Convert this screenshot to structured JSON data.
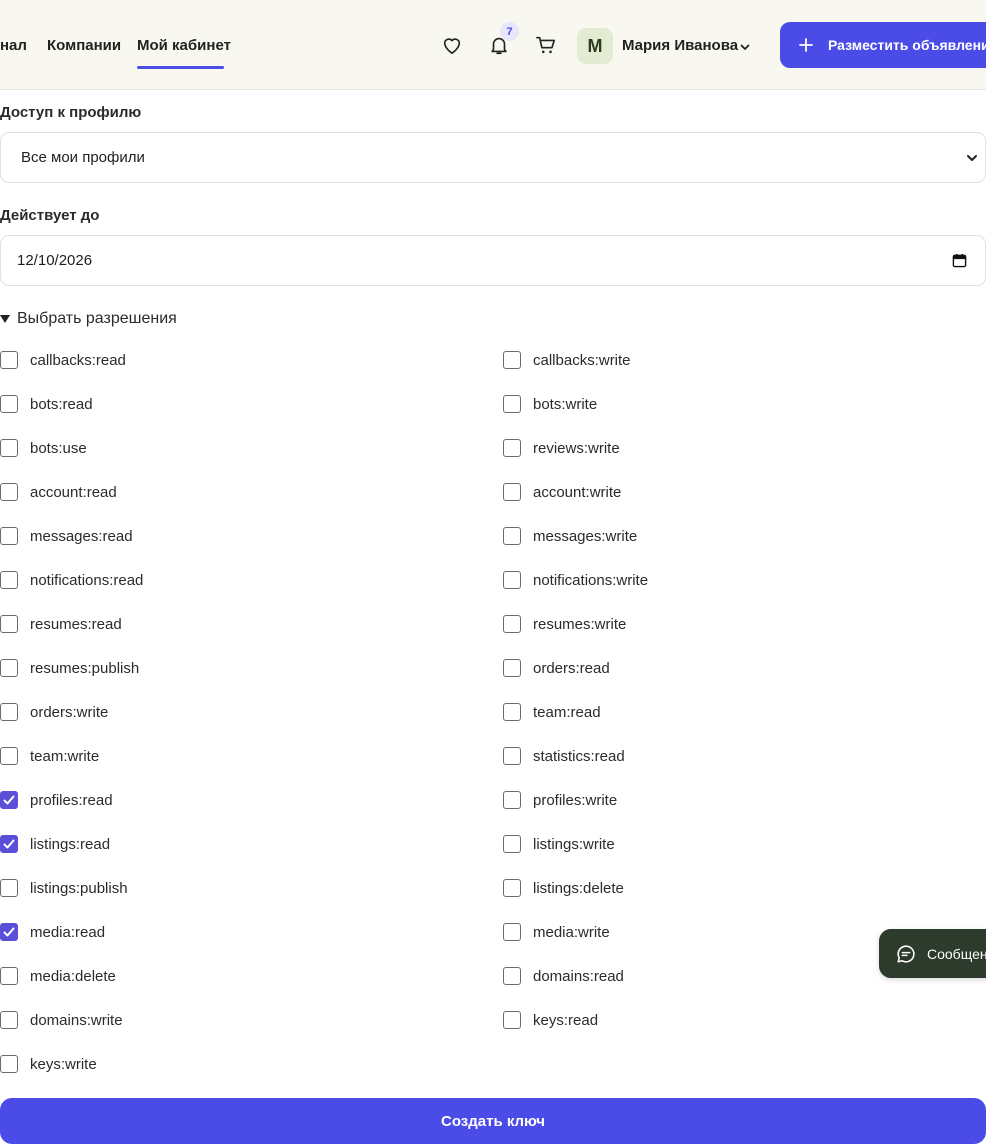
{
  "header": {
    "nav": [
      {
        "label": "нал"
      },
      {
        "label": "Компании"
      },
      {
        "label": "Мой кабинет"
      }
    ],
    "notifications_count": "7",
    "user": {
      "initial": "М",
      "name": "Мария Иванова"
    },
    "post_button_label": "Разместить объявление"
  },
  "form": {
    "profile_access": {
      "label": "Доступ к профилю",
      "value": "Все мои профили"
    },
    "valid_until": {
      "label": "Действует до",
      "value": "12/10/2026"
    },
    "permissions_summary": "Выбрать разрешения",
    "permissions": [
      {
        "name": "callbacks:read",
        "checked": false
      },
      {
        "name": "callbacks:write",
        "checked": false
      },
      {
        "name": "bots:read",
        "checked": false
      },
      {
        "name": "bots:write",
        "checked": false
      },
      {
        "name": "bots:use",
        "checked": false
      },
      {
        "name": "reviews:write",
        "checked": false
      },
      {
        "name": "account:read",
        "checked": false
      },
      {
        "name": "account:write",
        "checked": false
      },
      {
        "name": "messages:read",
        "checked": false
      },
      {
        "name": "messages:write",
        "checked": false
      },
      {
        "name": "notifications:read",
        "checked": false
      },
      {
        "name": "notifications:write",
        "checked": false
      },
      {
        "name": "resumes:read",
        "checked": false
      },
      {
        "name": "resumes:write",
        "checked": false
      },
      {
        "name": "resumes:publish",
        "checked": false
      },
      {
        "name": "orders:read",
        "checked": false
      },
      {
        "name": "orders:write",
        "checked": false
      },
      {
        "name": "team:read",
        "checked": false
      },
      {
        "name": "team:write",
        "checked": false
      },
      {
        "name": "statistics:read",
        "checked": false
      },
      {
        "name": "profiles:read",
        "checked": true
      },
      {
        "name": "profiles:write",
        "checked": false
      },
      {
        "name": "listings:read",
        "checked": true
      },
      {
        "name": "listings:write",
        "checked": false
      },
      {
        "name": "listings:publish",
        "checked": false
      },
      {
        "name": "listings:delete",
        "checked": false
      },
      {
        "name": "media:read",
        "checked": true
      },
      {
        "name": "media:write",
        "checked": false
      },
      {
        "name": "media:delete",
        "checked": false
      },
      {
        "name": "domains:read",
        "checked": false
      },
      {
        "name": "domains:write",
        "checked": false
      },
      {
        "name": "keys:read",
        "checked": false
      },
      {
        "name": "keys:write",
        "checked": false
      }
    ],
    "submit_label": "Создать ключ"
  },
  "chat_widget": {
    "label": "Сообщения"
  },
  "colors": {
    "accent": "#4b4ce8",
    "checkbox_checked": "#5b4fd8",
    "chat_bg": "#2c3b2c"
  }
}
